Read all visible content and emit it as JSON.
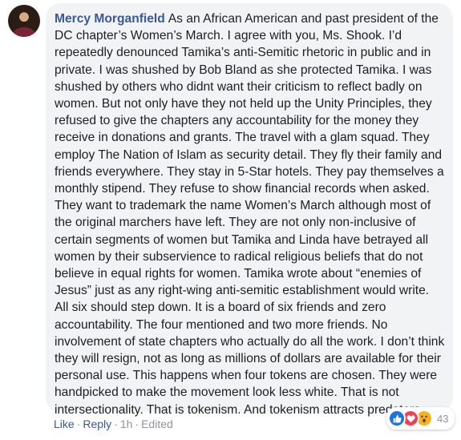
{
  "comment": {
    "author": "Mercy Morganfield",
    "text": "As an African American and past president of the DC chapter’s Women’s March. I agree with you, Ms. Shook. I’d repeatedly denounced Tamika’s anti-Semitic rhetoric in public and in private. I was shushed by Bob Bland as she protected Tamika. I was shushed by others who didnt want their criticism to reflect badly on women. But not only have they not held up the Unity Principles, they refused to give the chapters any accountability for the money they receive in donations and grants. The travel with a glam squad. They employ The Nation of Islam as security detail. They fly their family and friends everywhere. They stay in 5-Star hotels. They pay themselves a monthly stipend. They refuse to show financial records when asked. They want to trademark the name Women’s March although most of the original marchers have left. They are not only non-inclusive of certain segments of women but Tamika and Linda have betrayed all women by their subservience to radical religious beliefs that do not believe in equal rights for women. Tamika wrote about “enemies of Jesus” just as any right-wing anti-semitic establishment would write. All six should step down. It is a board of six friends and zero accountability. The four mentioned and two more friends. No involvement of state chapters who actually do all the work. I don’t think they will resign, not as long as millions of dollars are available for their personal use. This happens when four tokens are chosen. They were handpicked to make the movement look less white. That is not intersectionality. That is tokenism. And tokenism attracts predators."
  },
  "actions": {
    "like_label": "Like",
    "reply_label": "Reply",
    "separator": "·",
    "time": "1h",
    "edited_label": "Edited"
  },
  "reactions": {
    "icons": [
      "like-icon",
      "love-icon",
      "wow-icon"
    ],
    "count": "43",
    "colors": {
      "like": "#1b74e4",
      "love": "#f33e58",
      "wow": "#f7b125"
    }
  },
  "colors": {
    "author_link": "#385898",
    "bubble_bg": "#f2f3f5",
    "text": "#1c1e21",
    "meta": "#90949c"
  }
}
